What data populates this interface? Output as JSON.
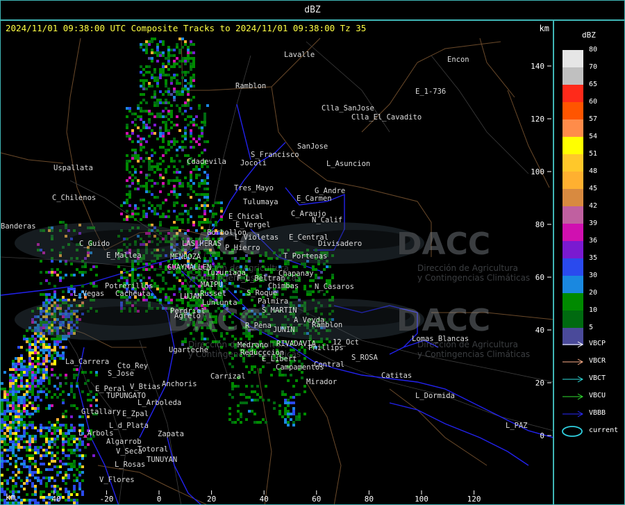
{
  "header": {
    "title": "dBZ"
  },
  "map": {
    "title": "2024/11/01 09:38:00 UTC Composite Tracks to 2024/11/01 09:38:00 Tz 35",
    "km_top": "km",
    "km_bottom": "km",
    "x_ticks": [
      "-40",
      "-20",
      "0",
      "20",
      "40",
      "60",
      "80",
      "100",
      "120"
    ],
    "y_ticks": [
      "140",
      "120",
      "100",
      "80",
      "60",
      "40",
      "20",
      "0"
    ],
    "places": [
      "Uspallata",
      "C_Chilenos",
      "C_Guido",
      "E_Mallea",
      "Potrerillos",
      "L_Vegas",
      "Cacheuta",
      "La_Carrera",
      "Cto_Rey",
      "S_Jose",
      "E_Peral",
      "V_Btias",
      "TUPUNGATO",
      "L_Arboleda",
      "Gltallary",
      "E_Zpal",
      "L_d_Plata",
      "L_Arbols",
      "Algarrob",
      "Zapata",
      "V_Seca",
      "Totoral",
      "L_Rosas",
      "TUNUYAN",
      "V_Flores",
      "Agrelo",
      "Perdriel",
      "LUJAN",
      "Ugarteche",
      "Anchoris",
      "Carrizal",
      "Ramblon",
      "Lavalle",
      "Jocoli",
      "S_Francisco",
      "Tres_Mayo",
      "Tulumaya",
      "E_Chical",
      "E_Vergel",
      "Borbollon",
      "LAS_HERAS",
      "P_Hierro",
      "L_Violetas",
      "GUAYMALLEN",
      "MENDOZA",
      "Tuzuriaga",
      "MAIPU",
      "Russel",
      "Lunlunta",
      "F_L_Beltran",
      "Chimbas",
      "S_Roque",
      "Palmira",
      "S_MARTIN",
      "R_Pena",
      "JUNIN",
      "A_Veyda",
      "Ramblon",
      "Medrano",
      "RIVADAVIA",
      "Phillips",
      "Reducccion",
      "E_Libert",
      "Campamentos",
      "Central",
      "12_Oct",
      "S_ROSA",
      "Mirador",
      "Catitas",
      "L_Dormida",
      "Lomas_Blancas",
      "L_PAZ",
      "Chapanay",
      "N_Casaros",
      "T_Portenas",
      "E_Central",
      "Divisadero",
      "C_Araujo",
      "N_Calif",
      "E_Carmen",
      "G_Andre",
      "L_Asuncion",
      "SanJose",
      "Clla_SanJose",
      "Clla_El_Cavadito",
      "E_1-736",
      "Encon",
      "Banderas",
      "Cdadevila"
    ],
    "watermark": {
      "brand": "DACC",
      "line1": "Dirección de Agricultura",
      "line2": "y Contingencias Climáticas"
    }
  },
  "legend": {
    "title": "dBZ",
    "scale": [
      {
        "label": "80",
        "color": "#e6e6e6"
      },
      {
        "label": "70",
        "color": "#c0c0c0"
      },
      {
        "label": "65",
        "color": "#ff2a1a"
      },
      {
        "label": "60",
        "color": "#ff5500"
      },
      {
        "label": "57",
        "color": "#ff8c4a"
      },
      {
        "label": "54",
        "color": "#ffff00"
      },
      {
        "label": "51",
        "color": "#ffc82a"
      },
      {
        "label": "48",
        "color": "#ffb030"
      },
      {
        "label": "45",
        "color": "#d88a40"
      },
      {
        "label": "42",
        "color": "#c060a0"
      },
      {
        "label": "39",
        "color": "#d010b0"
      },
      {
        "label": "36",
        "color": "#7a1ad0"
      },
      {
        "label": "35",
        "color": "#2a4aee"
      },
      {
        "label": "30",
        "color": "#1a88e0"
      },
      {
        "label": "20",
        "color": "#008a00"
      },
      {
        "label": "10",
        "color": "#006a10"
      },
      {
        "label": "5",
        "color": "#4a4a9a"
      }
    ],
    "tracks": [
      {
        "label": "VBCP",
        "color": "#ffffff"
      },
      {
        "label": "VBCR",
        "color": "#ffb08a"
      },
      {
        "label": "VBCT",
        "color": "#30e0e0"
      },
      {
        "label": "VBCU",
        "color": "#30e030"
      },
      {
        "label": "VBBB",
        "color": "#2a2aff"
      },
      {
        "label": "current",
        "color": "#30d0e0"
      }
    ]
  }
}
